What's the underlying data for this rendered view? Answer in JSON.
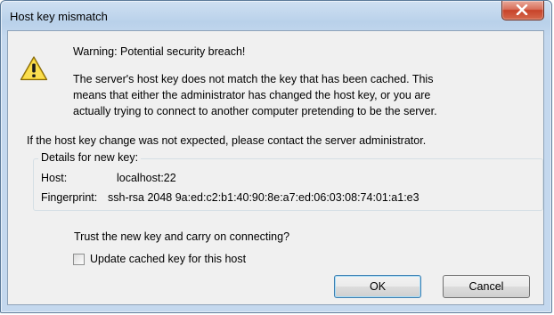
{
  "window": {
    "title": "Host key mismatch",
    "close_icon": "close-icon"
  },
  "content": {
    "warning_icon": "warning-icon",
    "headline": "Warning: Potential security breach!",
    "message_lines": [
      "The server's host key does not match the key that has been cached. This",
      "means that either the administrator has changed the host key, or you are",
      "actually trying to connect to another computer pretending to be the server."
    ],
    "contact_text": "If the host key change was not expected, please contact the server administrator.",
    "details": {
      "legend": "Details for new key:",
      "host_label": "Host:",
      "host_value": "localhost:22",
      "fingerprint_label": "Fingerprint:",
      "fingerprint_value": "ssh-rsa 2048 9a:ed:c2:b1:40:90:8e:a7:ed:06:03:08:74:01:a1:e3"
    },
    "trust_question": "Trust the new key and carry on connecting?",
    "checkbox": {
      "label": "Update cached key for this host",
      "checked": false
    }
  },
  "buttons": {
    "ok": "OK",
    "cancel": "Cancel"
  },
  "colors": {
    "close_button": "#c7432a",
    "warning_yellow": "#f7d12a",
    "default_button_border": "#3c7fb1"
  }
}
